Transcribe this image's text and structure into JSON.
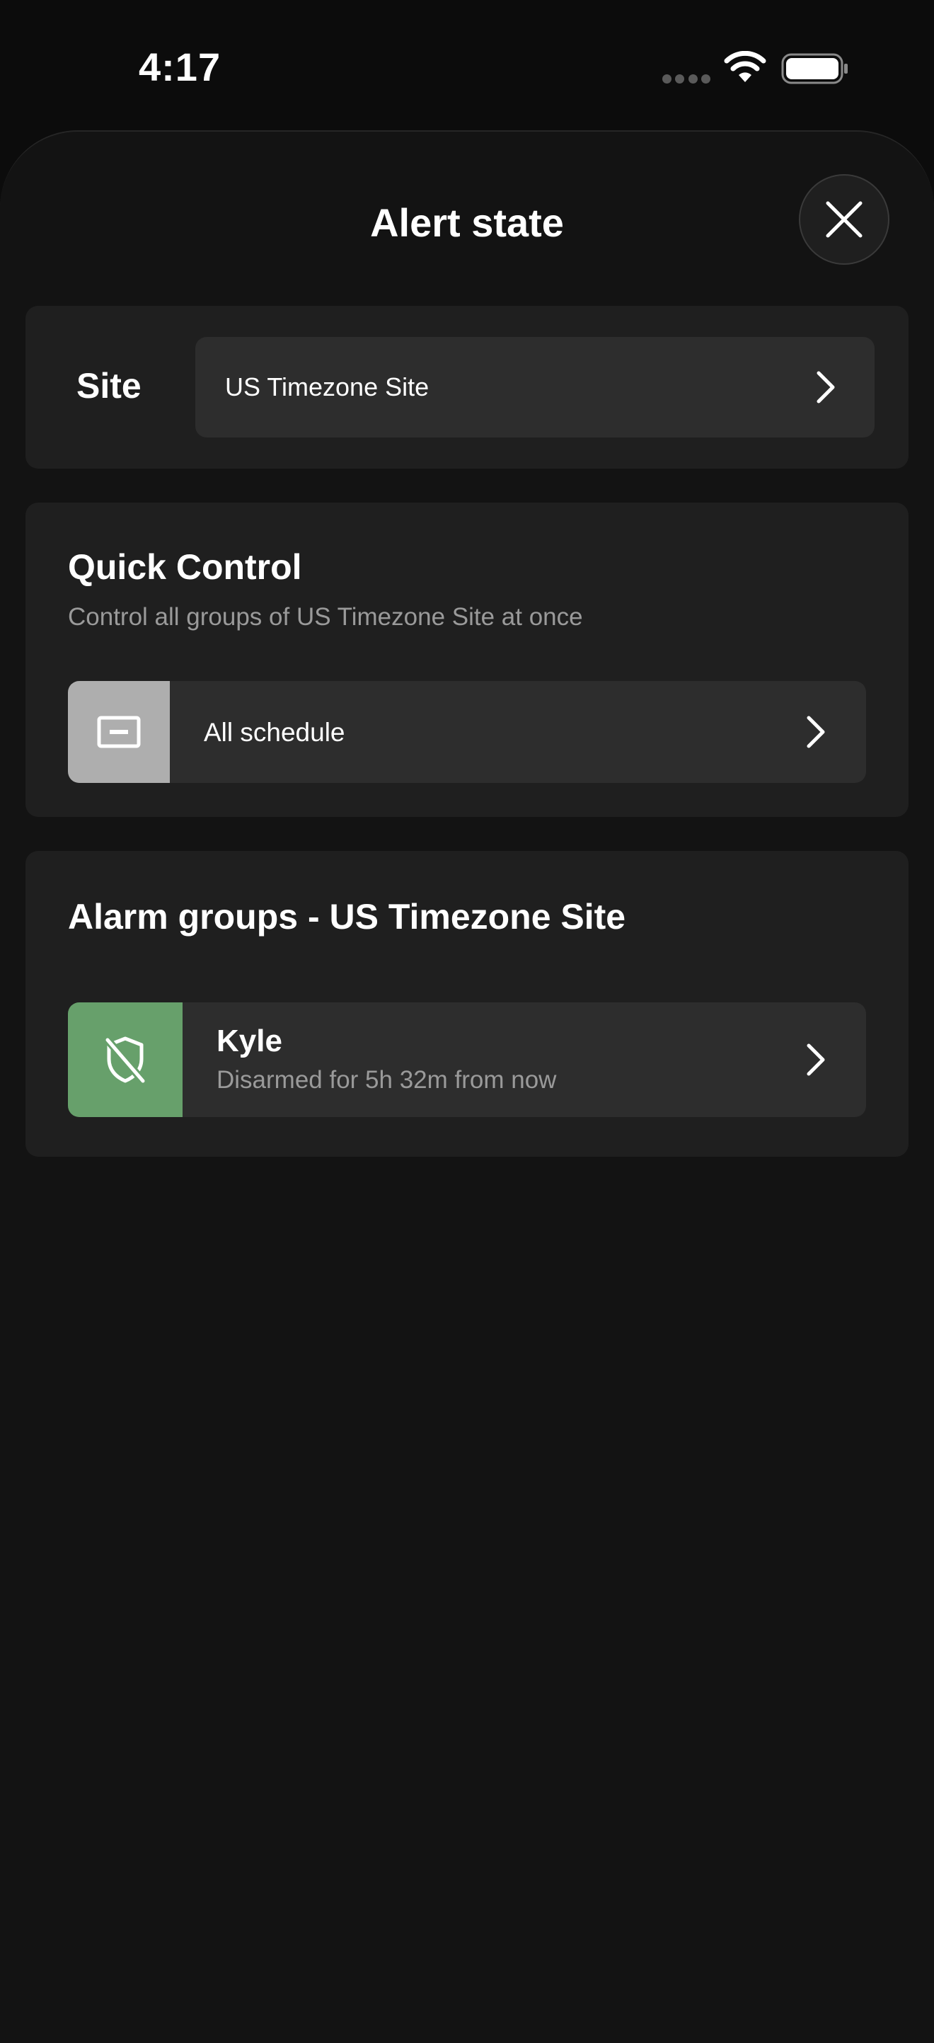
{
  "status_bar": {
    "time": "4:17"
  },
  "header": {
    "title": "Alert state",
    "close_icon": "close-icon"
  },
  "site": {
    "label": "Site",
    "value": "US Timezone Site"
  },
  "quick_control": {
    "title": "Quick Control",
    "subtitle": "Control all groups of US Timezone Site at once",
    "row": {
      "label": "All schedule",
      "icon": "schedule-icon",
      "icon_bg": "#aeaeae"
    }
  },
  "alarm_groups": {
    "title": "Alarm groups - US Timezone Site",
    "items": [
      {
        "name": "Kyle",
        "status": "Disarmed for 5h 32m from now",
        "icon": "shield-off-icon",
        "icon_bg": "#67a06b"
      }
    ]
  },
  "colors": {
    "background": "#0c0c0c",
    "sheet": "#131313",
    "card": "#1f1f1f",
    "row": "#2d2d2d",
    "muted_text": "#9a9a9a",
    "disarmed_green": "#67a06b"
  }
}
